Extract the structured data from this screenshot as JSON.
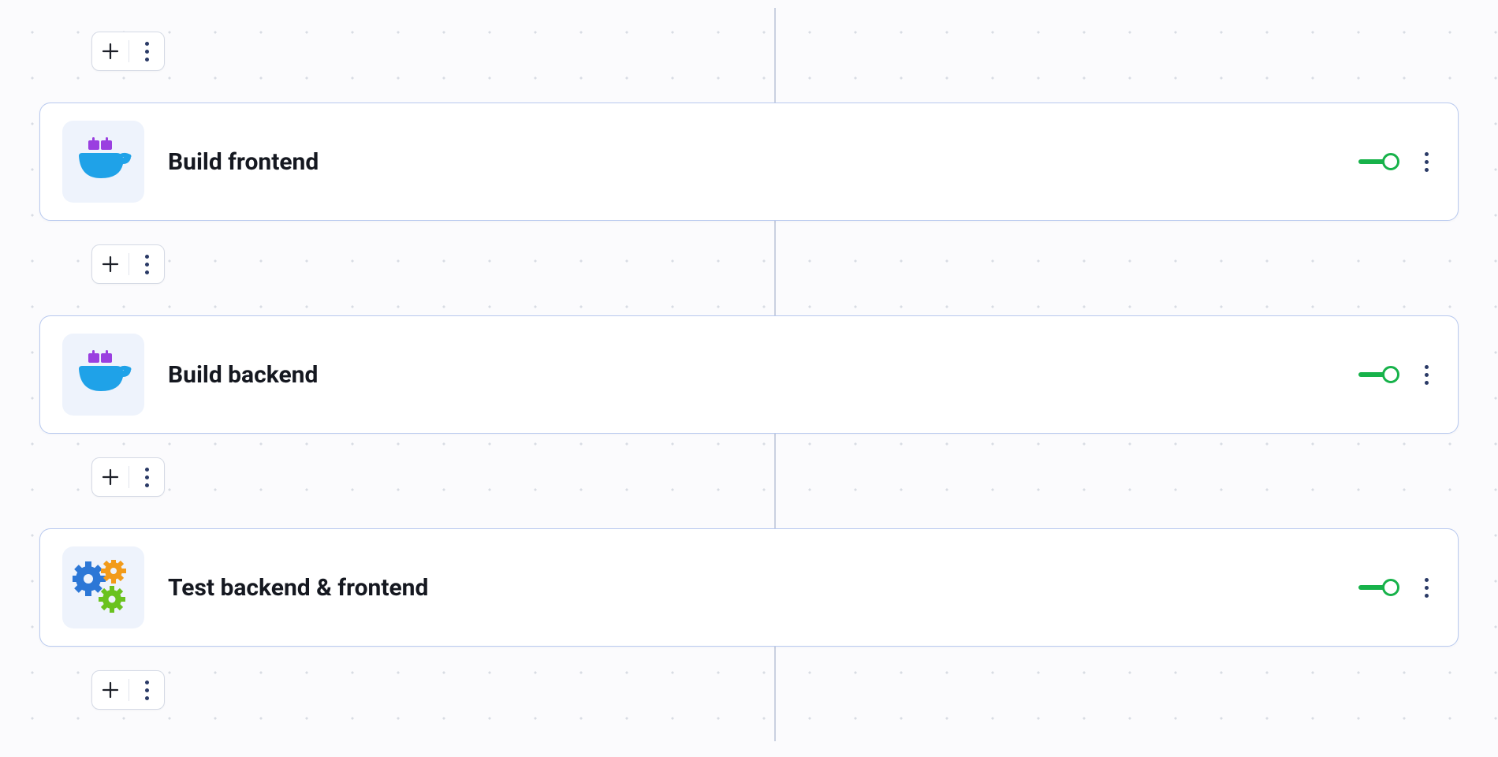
{
  "steps": [
    {
      "title": "Build frontend",
      "icon": "docker",
      "enabled": true
    },
    {
      "title": "Build backend",
      "icon": "docker",
      "enabled": true
    },
    {
      "title": "Test backend & frontend",
      "icon": "gears",
      "enabled": true
    }
  ],
  "icons": {
    "docker": "docker-icon",
    "gears": "gears-icon"
  }
}
